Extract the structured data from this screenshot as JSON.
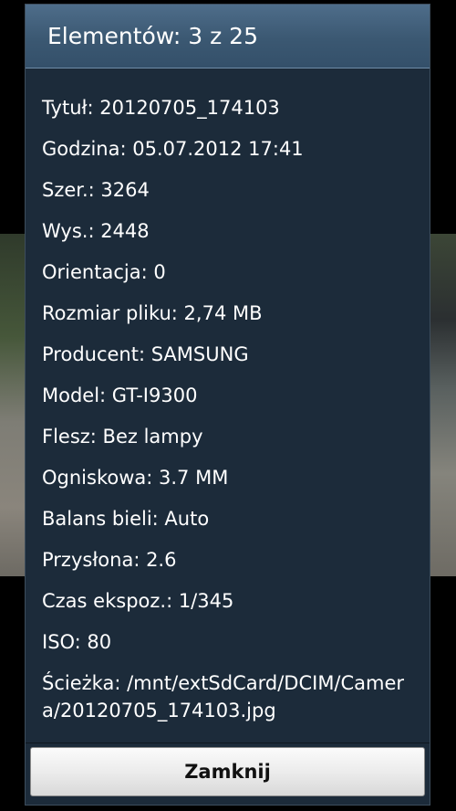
{
  "dialog": {
    "title": "Elementów: 3 z 25",
    "details": [
      "Tytuł: 20120705_174103",
      "Godzina: 05.07.2012 17:41",
      "Szer.: 3264",
      "Wys.: 2448",
      "Orientacja: 0",
      "Rozmiar pliku: 2,74 MB",
      "Producent: SAMSUNG",
      "Model: GT-I9300",
      "Flesz: Bez lampy",
      "Ogniskowa: 3.7 MM",
      "Balans bieli: Auto",
      "Przysłona: 2.6",
      "Czas ekspoz.: 1/345",
      "ISO: 80",
      "Ścieżka: /mnt/extSdCard/DCIM/Camera/20120705_174103.jpg"
    ],
    "close_label": "Zamknij"
  },
  "colors": {
    "header": "#3b5872",
    "body": "#1c2b3a",
    "button": "#ececec"
  }
}
